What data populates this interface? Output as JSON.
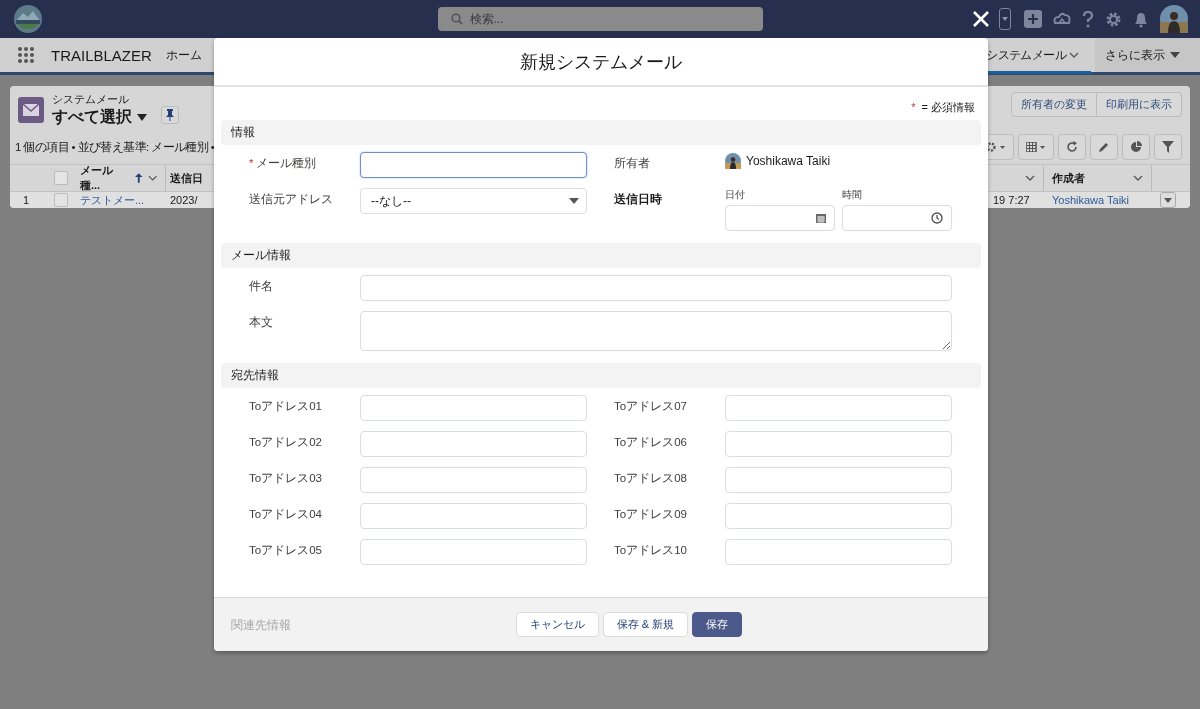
{
  "global_header": {
    "search": {
      "placeholder": "検索..."
    }
  },
  "nav": {
    "app_name": "TRAILBLAZER",
    "items": [
      {
        "label": "ホーム",
        "kind": "plain",
        "selected": false
      },
      {
        "label": "システムメール",
        "kind": "chevron",
        "selected": true
      },
      {
        "label": "さらに表示",
        "kind": "more",
        "selected": false
      }
    ]
  },
  "list_view": {
    "object": "システムメール",
    "title": "すべて選択",
    "summary": "1 個の項目 • 並び替え基準: メール種別 •",
    "actions": [
      "所有者の変更",
      "印刷用に表示"
    ],
    "select_all_checked": false,
    "columns": [
      {
        "label": "メール種...",
        "sorted": true
      },
      {
        "label": "送信日",
        "sorted": false
      },
      {
        "label": "作成者",
        "sorted": false
      }
    ],
    "rows": [
      {
        "number": "1",
        "checked": false,
        "type": "テストメー...",
        "sent": "2023/",
        "time": "19 7:27",
        "creator": "Yoshikawa Taiki"
      }
    ]
  },
  "modal": {
    "title": "新規システムメール",
    "required_legend": {
      "mark": "*",
      "text": "= 必須情報"
    },
    "sections": [
      {
        "title": "情報",
        "fields": [
          {
            "kind": "text",
            "label": "メール種別",
            "required": true,
            "mark": "*",
            "focused": true
          },
          {
            "kind": "owner",
            "label": "所有者",
            "required": false,
            "value": "Yoshikawa Taiki"
          },
          {
            "kind": "select",
            "label": "送信元アドレス",
            "required": false,
            "value": "--なし--"
          },
          {
            "kind": "datetime",
            "label": "送信日時",
            "required": false,
            "date_label": "日付",
            "time_label": "時間"
          }
        ]
      },
      {
        "title": "メール情報",
        "fields": [
          {
            "kind": "wide",
            "label": "件名",
            "required": false,
            "focused": false
          },
          {
            "kind": "textarea",
            "label": "本文",
            "required": false
          }
        ]
      },
      {
        "title": "宛先情報",
        "fields": [
          {
            "kind": "text",
            "label": "Toアドレス01",
            "required": false,
            "focused": false
          },
          {
            "kind": "text",
            "label": "Toアドレス07",
            "required": false,
            "focused": false
          },
          {
            "kind": "text",
            "label": "Toアドレス02",
            "required": false,
            "focused": false
          },
          {
            "kind": "text",
            "label": "Toアドレス06",
            "required": false,
            "focused": false
          },
          {
            "kind": "text",
            "label": "Toアドレス03",
            "required": false,
            "focused": false
          },
          {
            "kind": "text",
            "label": "Toアドレス08",
            "required": false,
            "focused": false
          },
          {
            "kind": "text",
            "label": "Toアドレス04",
            "required": false,
            "focused": false
          },
          {
            "kind": "text",
            "label": "Toアドレス09",
            "required": false,
            "focused": false
          },
          {
            "kind": "text",
            "label": "Toアドレス05",
            "required": false,
            "focused": false
          },
          {
            "kind": "text",
            "label": "Toアドレス10",
            "required": false,
            "focused": false
          }
        ]
      }
    ],
    "hidden_section": "関連先情報",
    "buttons": [
      {
        "label": "キャンセル",
        "kind": "neutral"
      },
      {
        "label": "保存 & 新規",
        "kind": "neutral"
      },
      {
        "label": "保存",
        "kind": "brand"
      }
    ]
  }
}
